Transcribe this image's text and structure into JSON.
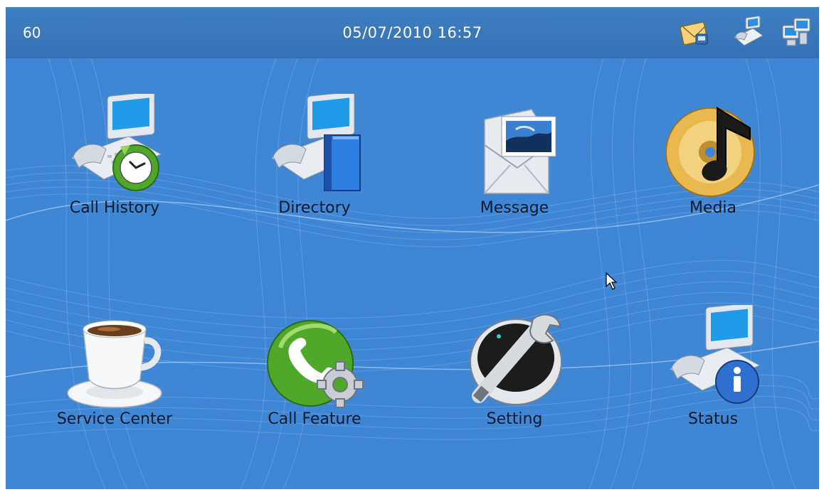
{
  "status_bar": {
    "line_count": "60",
    "datetime": "05/07/2010 16:57",
    "icons": [
      "message-envelope-icon",
      "phone-device-icon",
      "network-computers-icon"
    ]
  },
  "menu": {
    "items": [
      {
        "label": "Call History",
        "icon": "call-history-icon"
      },
      {
        "label": "Directory",
        "icon": "directory-book-icon"
      },
      {
        "label": "Message",
        "icon": "message-envelope-icon"
      },
      {
        "label": "Media",
        "icon": "media-disc-icon"
      },
      {
        "label": "Service Center",
        "icon": "coffee-cup-icon"
      },
      {
        "label": "Call Feature",
        "icon": "call-feature-gear-icon"
      },
      {
        "label": "Setting",
        "icon": "wrench-icon"
      },
      {
        "label": "Status",
        "icon": "status-info-icon"
      }
    ]
  },
  "colors": {
    "background": "#3f86d4",
    "status_bar": "#3570b3",
    "label_text": "#0d1a2b"
  }
}
